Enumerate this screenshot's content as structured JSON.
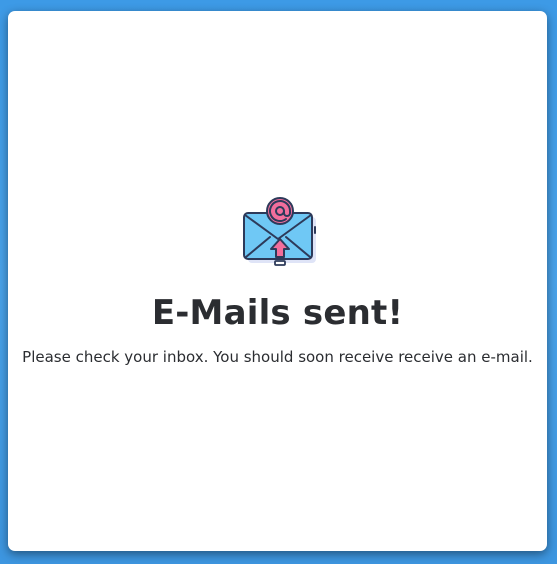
{
  "dialog": {
    "icon": "email-sent-icon",
    "title": "E-Mails sent!",
    "message": "Please check your inbox. You should soon receive receive an e-mail."
  },
  "colors": {
    "envelope": "#6fc8f5",
    "envelope_outline": "#2d3a5a",
    "accent_pink": "#f26e9c",
    "text": "#2b2d31",
    "background": "#4aa3ea"
  }
}
